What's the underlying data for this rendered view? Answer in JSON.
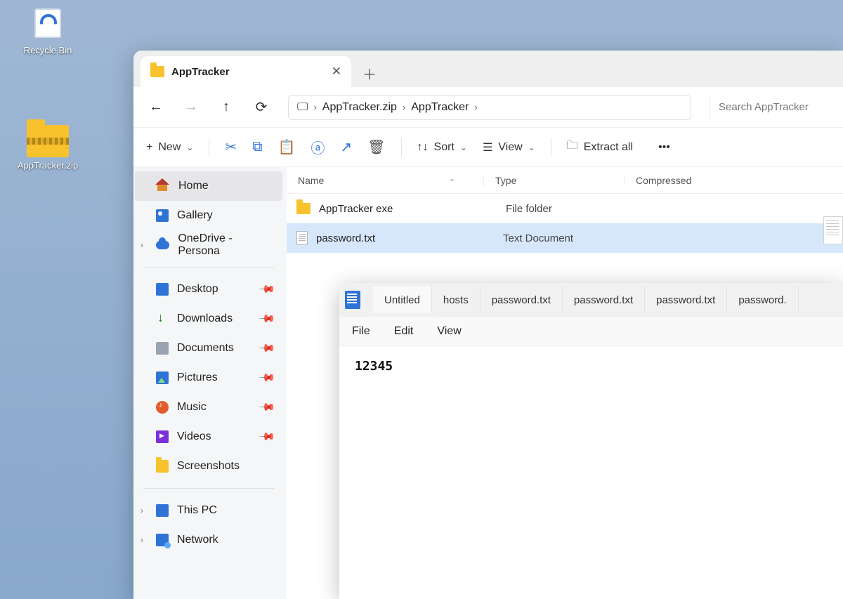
{
  "desktop": {
    "recycle_bin_label": "Recycle Bin",
    "zip_label": "AppTracker.zip"
  },
  "explorer": {
    "tab_title": "AppTracker",
    "breadcrumb": [
      "AppTracker.zip",
      "AppTracker"
    ],
    "search_placeholder": "Search AppTracker",
    "toolbar": {
      "new_label": "New",
      "sort_label": "Sort",
      "view_label": "View",
      "extract_label": "Extract all"
    },
    "sidebar": {
      "home": "Home",
      "gallery": "Gallery",
      "onedrive": "OneDrive - Persona",
      "desktop": "Desktop",
      "downloads": "Downloads",
      "documents": "Documents",
      "pictures": "Pictures",
      "music": "Music",
      "videos": "Videos",
      "screenshots": "Screenshots",
      "this_pc": "This PC",
      "network": "Network"
    },
    "columns": {
      "name": "Name",
      "type": "Type",
      "compressed": "Compressed"
    },
    "rows": [
      {
        "name": "AppTracker exe",
        "type": "File folder",
        "kind": "folder",
        "selected": false
      },
      {
        "name": "password.txt",
        "type": "Text Document",
        "kind": "text",
        "selected": true
      }
    ]
  },
  "notepad": {
    "tabs": [
      "Untitled",
      "hosts",
      "password.txt",
      "password.txt",
      "password.txt",
      "password."
    ],
    "menu": {
      "file": "File",
      "edit": "Edit",
      "view": "View"
    },
    "content": "12345"
  }
}
